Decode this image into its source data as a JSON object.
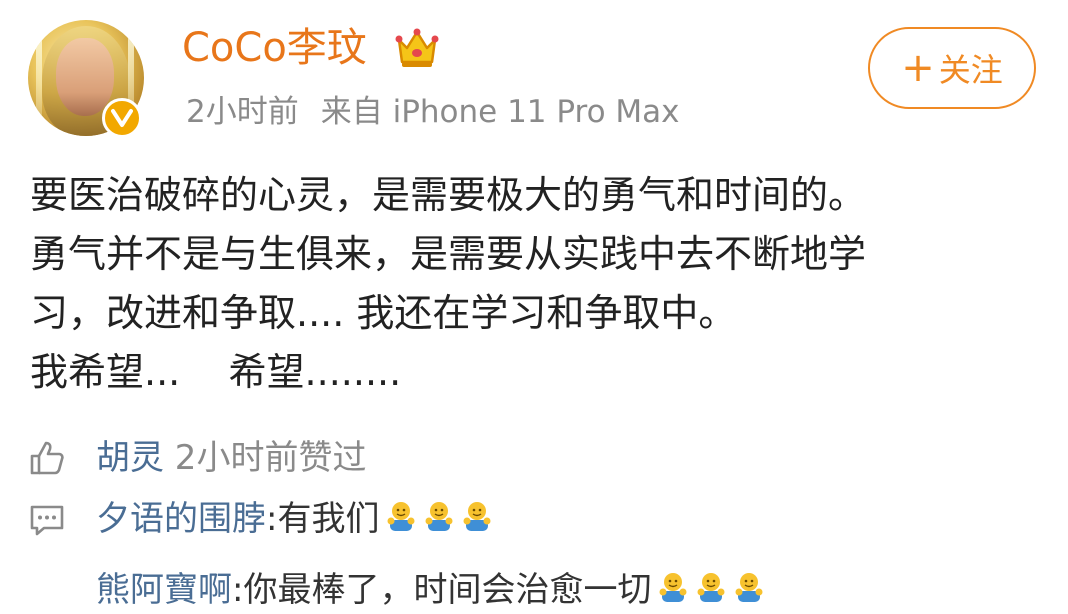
{
  "post": {
    "author": {
      "name": "CoCo李玟",
      "avatar_icon": "user-avatar",
      "verified_icon": "verified-v-icon",
      "member_icon": "crown-icon"
    },
    "meta": {
      "time": "2小时前",
      "source": "来自 iPhone 11 Pro Max"
    },
    "follow_button": {
      "label": "关注",
      "icon": "plus-icon"
    },
    "content_lines": [
      "要医治破碎的心灵，是需要极大的勇气和时间的。",
      "勇气并不是与生俱来，是需要从实践中去不断地学",
      "习，改进和争取.... 我还在学习和争取中。",
      "我希望...    希望........"
    ]
  },
  "interactions": {
    "like": {
      "icon": "thumbs-up-icon",
      "user": "胡灵",
      "text": " 2小时前赞过"
    },
    "comments": [
      {
        "icon": "comment-icon",
        "user": "夕语的围脖",
        "text": ":有我们"
      },
      {
        "user": "熊阿寶啊",
        "text": ":你最棒了，时间会治愈一切"
      }
    ],
    "emoji_icon": "hug-emoji-icon"
  },
  "colors": {
    "username": "#e8761a",
    "follow": "#f08a24",
    "link": "#4a6d94",
    "muted": "#8a8a8a",
    "badge": "#f2a800"
  }
}
